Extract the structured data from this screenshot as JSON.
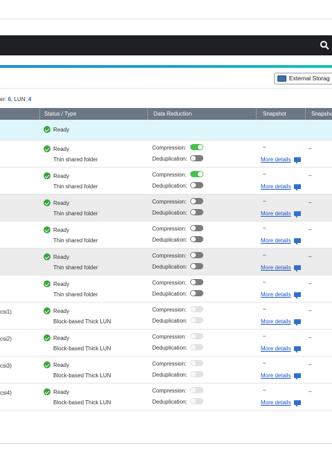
{
  "toolbar": {
    "external_storage_label": "External Storag"
  },
  "summary": {
    "prefix": "er: ",
    "shared_folder_count": "6",
    "lun_label": ", LUN: ",
    "lun_count": "4"
  },
  "columns": {
    "status": "Status / Type",
    "data_reduction": "Data Reduction",
    "snapshot": "Snapshot",
    "snapshot2": "Snapsho"
  },
  "labels": {
    "compression": "Compression:",
    "deduplication": "Deduplication:",
    "more_details": "More details",
    "dash": "–"
  },
  "rows": [
    {
      "name": "",
      "status": "Ready",
      "type": "",
      "compression": "",
      "dedup": "",
      "snapshot": "",
      "snapshot2": ""
    },
    {
      "name": "",
      "status": "Ready",
      "type": "Thin shared folder",
      "compression": "on",
      "dedup": "off",
      "snapshot": "–",
      "snapshot2": "–"
    },
    {
      "name": "",
      "status": "Ready",
      "type": "Thin shared folder",
      "compression": "on",
      "dedup": "off",
      "snapshot": "–",
      "snapshot2": "–"
    },
    {
      "name": "",
      "status": "Ready",
      "type": "Thin shared folder",
      "compression": "off",
      "dedup": "off",
      "snapshot": "–",
      "snapshot2": "–"
    },
    {
      "name": "",
      "status": "Ready",
      "type": "Thin shared folder",
      "compression": "off",
      "dedup": "off",
      "snapshot": "–",
      "snapshot2": "–"
    },
    {
      "name": "",
      "status": "Ready",
      "type": "Thin shared folder",
      "compression": "off",
      "dedup": "off",
      "snapshot": "–",
      "snapshot2": "–"
    },
    {
      "name": "",
      "status": "Ready",
      "type": "Thin shared folder",
      "compression": "off",
      "dedup": "off",
      "snapshot": "–",
      "snapshot2": "–"
    },
    {
      "name": "csi1)",
      "status": "Ready",
      "type": "Block-based Thick LUN",
      "compression": "disabled",
      "dedup": "disabled",
      "snapshot": "–",
      "snapshot2": "–"
    },
    {
      "name": "csi2)",
      "status": "Ready",
      "type": "Block-based Thick LUN",
      "compression": "disabled",
      "dedup": "disabled",
      "snapshot": "–",
      "snapshot2": "–"
    },
    {
      "name": "csi3)",
      "status": "Ready",
      "type": "Block-based Thick LUN",
      "compression": "disabled",
      "dedup": "disabled",
      "snapshot": "–",
      "snapshot2": "–"
    },
    {
      "name": "csi4)",
      "status": "Ready",
      "type": "Block-based Thick LUN",
      "compression": "disabled",
      "dedup": "disabled",
      "snapshot": "–",
      "snapshot2": "–"
    }
  ],
  "colors": {
    "accent_start": "#1f8fd6",
    "accent_end": "#17c2b3",
    "header_bg": "#6b7785",
    "selected_row": "#dff6fb",
    "ok_green": "#3ba53b",
    "toggle_on": "#45c24a"
  },
  "icons": {
    "search": "search-icon",
    "external_storage": "storage-icon",
    "status": "check-circle-icon",
    "details": "chat-icon"
  }
}
